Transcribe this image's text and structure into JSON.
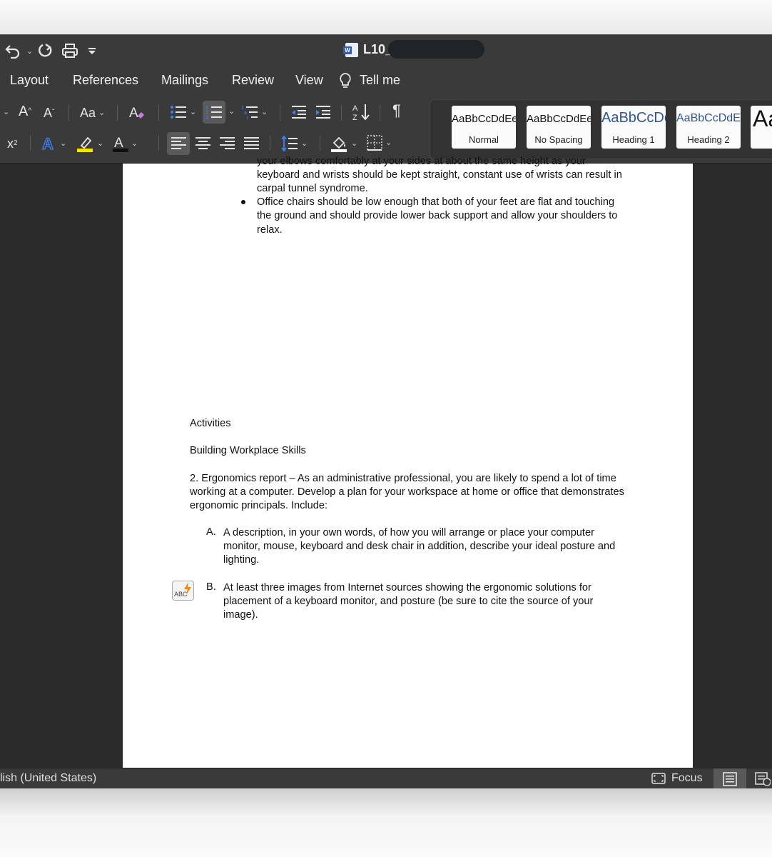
{
  "window": {
    "title": "L10_",
    "quick_access": [
      "undo-icon",
      "chevron-down-icon",
      "redo-icon",
      "print-icon",
      "customize-icon"
    ]
  },
  "menu": {
    "tabs": [
      "Layout",
      "References",
      "Mailings",
      "Review",
      "View"
    ],
    "tell_me": "Tell me"
  },
  "ribbon": {
    "font_size_increase": "A",
    "font_size_decrease": "A",
    "change_case": "Aa",
    "superscript": "x",
    "styles": [
      {
        "sample": "AaBbCcDdEe",
        "name": "Normal"
      },
      {
        "sample": "AaBbCcDdEe",
        "name": "No Spacing"
      },
      {
        "sample": "AaBbCcDc",
        "name": "Heading 1"
      },
      {
        "sample": "AaBbCcDdEe",
        "name": "Heading 2"
      },
      {
        "sample": "Aa",
        "name": ""
      }
    ],
    "colors": {
      "highlight": "#f5e400",
      "font_color": "#111111",
      "text_effects": "#3b82f6"
    }
  },
  "page1": {
    "cut_line": "your elbows comfortably at your sides at about the same height as your",
    "line1": "keyboard and wrists should be kept straight, constant use of wrists can result in",
    "line2": "carpal tunnel syndrome.",
    "bullet_line1": "Office chairs should be low enough that both of your feet are flat and touching",
    "bullet_line2": "the ground and should provide lower back support and allow your shoulders to",
    "bullet_line3": "relax."
  },
  "page2": {
    "activities": "Activities",
    "subheading": "Building Workplace Skills",
    "p1": "2. Ergonomics report – As an administrative professional, you are likely to spend a lot of time",
    "p2": "working at a computer. Develop a plan for your workspace at home or office that demonstrates",
    "p3": "ergonomic principals. Include:",
    "a_label": "A.",
    "a1": "A description, in your own words, of how you will arrange or place your computer",
    "a2": "monitor, mouse, keyboard and desk chair in addition, describe your ideal posture and",
    "a3": "lighting.",
    "b_label": "B.",
    "b1": "At least three images from Internet sources showing the ergonomic solutions for",
    "b2": "placement of a keyboard monitor, and posture (be sure to cite the source of your",
    "b3": "image).",
    "spell_icon_label": "ABC"
  },
  "status": {
    "language": "lish (United States)",
    "focus": "Focus"
  }
}
